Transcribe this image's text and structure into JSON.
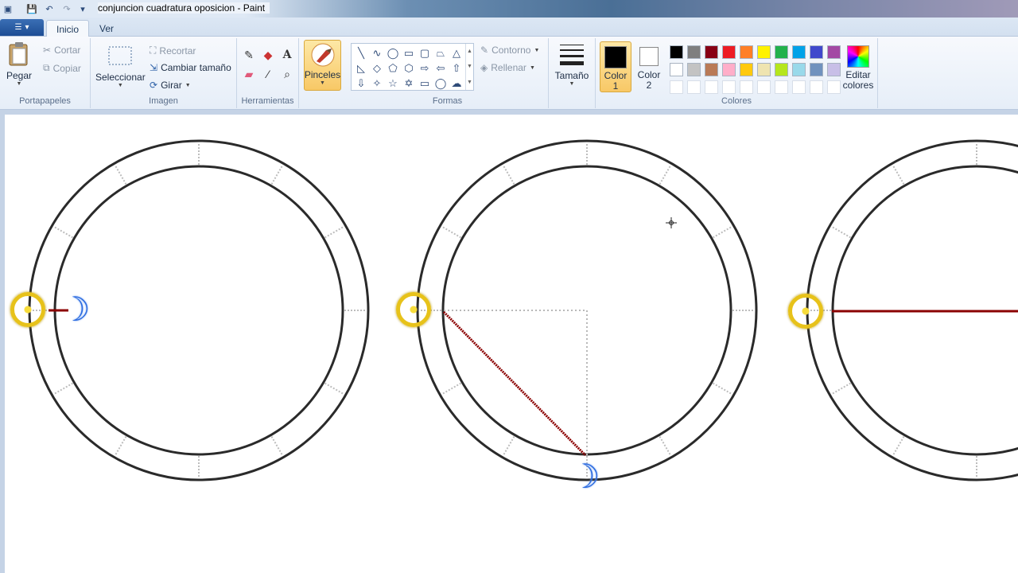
{
  "window": {
    "title": "conjuncion cuadratura oposicion - Paint"
  },
  "quick_access": [
    "paint-app-icon",
    "save-icon",
    "undo-icon",
    "redo-icon",
    "customize-caret-icon"
  ],
  "tabs": [
    {
      "label": "Inicio",
      "active": true
    },
    {
      "label": "Ver",
      "active": false
    }
  ],
  "ribbon": {
    "clipboard": {
      "paste": "Pegar",
      "cut": "Cortar",
      "copy": "Copiar",
      "group": "Portapapeles"
    },
    "image": {
      "select": "Seleccionar",
      "crop": "Recortar",
      "resize": "Cambiar tamaño",
      "rotate": "Girar",
      "group": "Imagen"
    },
    "tools": {
      "group": "Herramientas"
    },
    "brushes": {
      "label": "Pinceles"
    },
    "shapes": {
      "outline": "Contorno",
      "fill": "Rellenar",
      "group": "Formas"
    },
    "size": {
      "label": "Tamaño"
    },
    "colors": {
      "color1_line1": "Color",
      "color1_line2": "1",
      "color2_line1": "Color",
      "color2_line2": "2",
      "edit_line1": "Editar",
      "edit_line2": "colores",
      "group": "Colores",
      "color1": "#000000",
      "color2": "#ffffff",
      "palette": [
        "#000000",
        "#7f7f7f",
        "#880015",
        "#ed1c24",
        "#ff7f27",
        "#fff200",
        "#22b14c",
        "#00a2e8",
        "#3f48cc",
        "#a349a4",
        "#ffffff",
        "#c3c3c3",
        "#b97a57",
        "#ffaec9",
        "#ffc90e",
        "#efe4b0",
        "#b5e61d",
        "#99d9ea",
        "#7092be",
        "#c8bfe7",
        "#ffffff",
        "#ffffff",
        "#ffffff",
        "#ffffff",
        "#ffffff",
        "#ffffff",
        "#ffffff",
        "#ffffff",
        "#ffffff",
        "#ffffff"
      ]
    }
  },
  "canvas": {
    "ring_color": "#2a2a2a",
    "aspect_line_color": "#8b0000",
    "sun_color": "#e7c21a",
    "moon_color": "#2c6be0",
    "moon_glyph": "☽"
  }
}
